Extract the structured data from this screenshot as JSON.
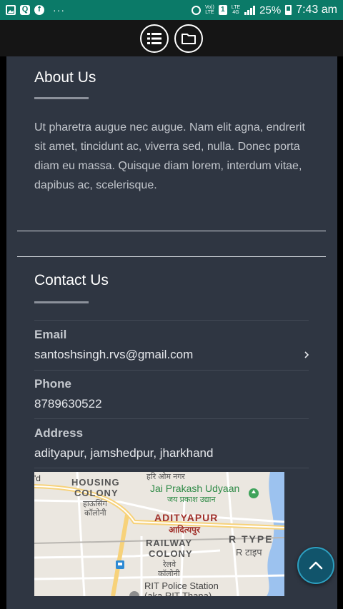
{
  "status_bar": {
    "left_icons": [
      "gallery-icon",
      "q-app-icon",
      "facebook-icon"
    ],
    "more": "···",
    "volte_top": "Vo))",
    "volte_bottom": "LTE",
    "sim": "1",
    "lte_top": "LTE",
    "lte_bottom": "4G",
    "battery": "25%",
    "time": "7:43 am"
  },
  "top_bar": {
    "buttons": [
      "list-icon",
      "folder-icon"
    ]
  },
  "about": {
    "title": "About Us",
    "body": "Ut pharetra augue nec augue. Nam elit agna, endrerit sit amet, tincidunt ac, viverra sed, nulla. Donec porta diam eu massa. Quisque diam lorem, interdum vitae, dapibus ac, scelerisque."
  },
  "contact": {
    "title": "Contact Us",
    "email_label": "Email",
    "email": "santoshsingh.rvs@gmail.com",
    "phone_label": "Phone",
    "phone": "8789630522",
    "address_label": "Address",
    "address": "adityapur, jamshedpur, jharkhand"
  },
  "map": {
    "labels": {
      "edge": "'d",
      "hari_om": "हरि ओम नगर",
      "housing1": "HOUSING",
      "housing2": "COLONY",
      "housing_hi1": "हाऊसिंग",
      "housing_hi2": "कॉलोनी",
      "udyaan": "Jai Prakash Udyaan",
      "udyaan_hi": "जय प्रकाश उद्यान",
      "adityapur": "ADITYAPUR",
      "adityapur_hi": "आदित्यपुर",
      "railway1": "RAILWAY",
      "railway2": "COLONY",
      "railway_hi1": "रेलवे",
      "railway_hi2": "कॉलोनी",
      "rtype": "R TYPE",
      "rtype_hi": "R टाइप",
      "police": "RIT Police Station",
      "police2": "(aka RIT Thana)"
    },
    "colors": {
      "road": "#f7d27a",
      "park_pin": "#3ea35a",
      "river": "#7fb0e8"
    }
  },
  "fab": {
    "icon": "chevron-up-icon"
  },
  "colors": {
    "status_bar": "#0b7a68",
    "card": "#2f3642",
    "fab": "#11546b"
  }
}
